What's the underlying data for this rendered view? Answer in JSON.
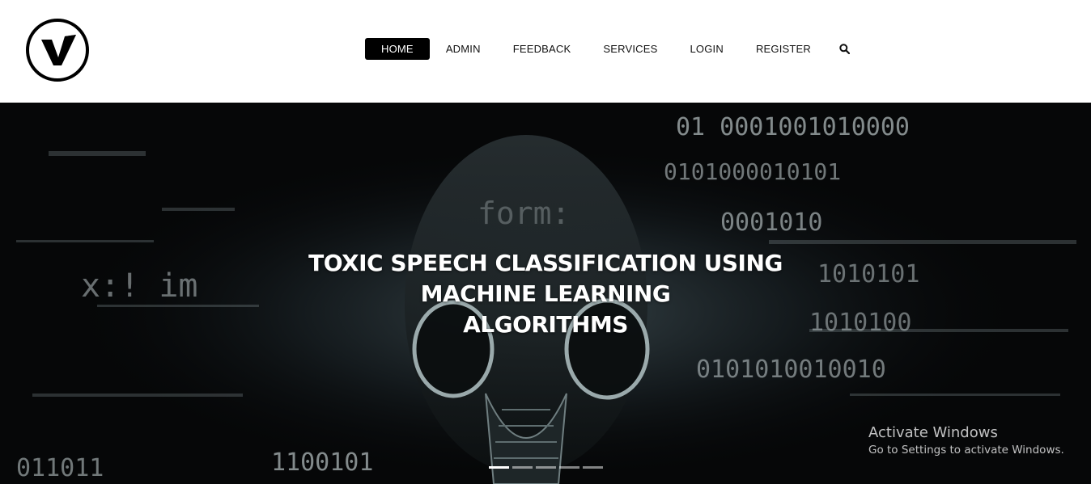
{
  "brand": {
    "logo_letter": "V"
  },
  "nav": {
    "items": [
      {
        "label": "HOME",
        "active": true
      },
      {
        "label": "ADMIN",
        "active": false
      },
      {
        "label": "FEEDBACK",
        "active": false
      },
      {
        "label": "SERVICES",
        "active": false
      },
      {
        "label": "LOGIN",
        "active": false
      },
      {
        "label": "REGISTER",
        "active": false
      }
    ],
    "search_icon": "search-icon"
  },
  "hero": {
    "title_line1": "TOXIC SPEECH CLASSIFICATION USING",
    "title_line2": "MACHINE LEARNING",
    "title_line3": "ALGORITHMS",
    "binary_texts": [
      "01 0001001010000",
      "0101000010101",
      "0001010",
      "1010101",
      "1010100",
      "0101010010010",
      "011011",
      "1100101",
      "form:",
      "x:! im"
    ],
    "slide_count": 5,
    "active_slide": 1
  },
  "watermark": {
    "title": "Activate Windows",
    "subtitle": "Go to Settings to activate Windows."
  }
}
